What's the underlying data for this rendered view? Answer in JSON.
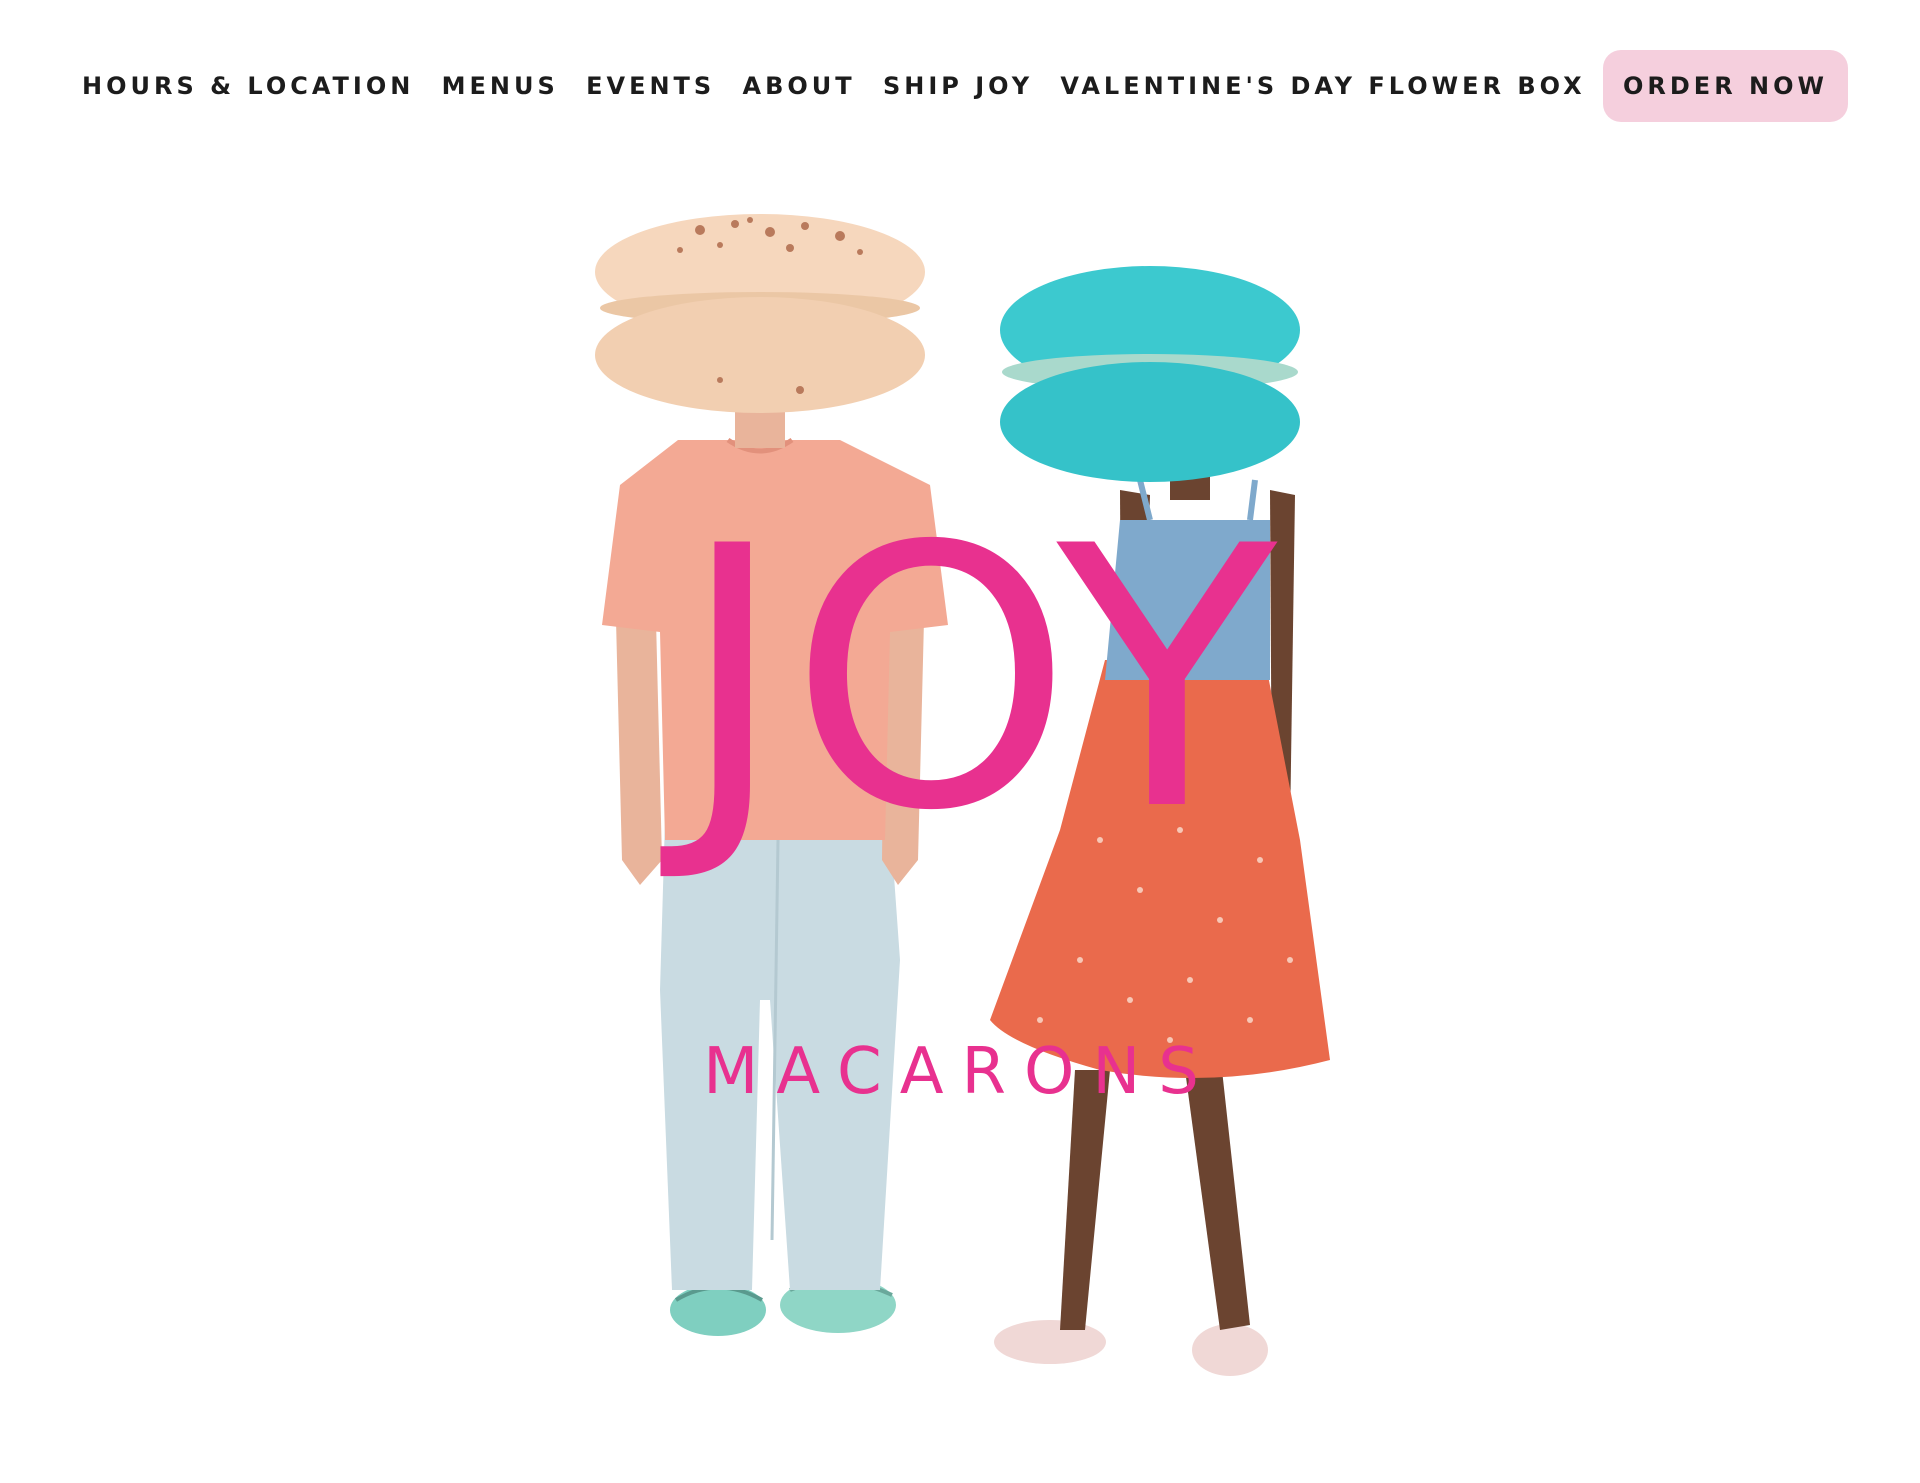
{
  "nav": {
    "items": [
      {
        "label": "HOURS & LOCATION",
        "name": "nav-hours-location"
      },
      {
        "label": "MENUS",
        "name": "nav-menus"
      },
      {
        "label": "EVENTS",
        "name": "nav-events"
      },
      {
        "label": "ABOUT",
        "name": "nav-about"
      },
      {
        "label": "SHIP JOY",
        "name": "nav-ship-joy"
      },
      {
        "label": "VALENTINE'S DAY FLOWER BOX",
        "name": "nav-valentines-flower-box"
      }
    ],
    "cta": {
      "label": "ORDER NOW"
    }
  },
  "hero": {
    "logo_main": "JOY",
    "logo_sub": "MACARONS",
    "image_subjects": [
      "almond-macaron-head-figure",
      "turquoise-macaron-head-figure"
    ]
  },
  "colors": {
    "brand_pink": "#e8318f",
    "cta_bg": "#f5cfdd",
    "nav_text": "#1c1c1c",
    "background": "#ffffff"
  }
}
